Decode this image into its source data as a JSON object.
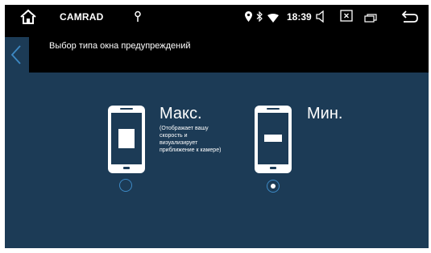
{
  "statusbar": {
    "app_name": "CAMRAD",
    "time": "18:39",
    "icons": [
      "home-icon",
      "pin-icon",
      "location-icon",
      "bluetooth-icon",
      "wifi-icon",
      "volume-icon",
      "close-box-icon",
      "window-icon",
      "back-arrow-icon"
    ]
  },
  "titlebar": {
    "title": "Выбор типа окна предупреждений"
  },
  "options": [
    {
      "label": "Макс.",
      "description": "(Отображает вашу скорость и визуализирует приближение к камере)",
      "selected": false
    },
    {
      "label": "Мин.",
      "description": "",
      "selected": true
    }
  ],
  "colors": {
    "background": "#1c3b56",
    "bar": "#000000",
    "accent": "#3d89c4",
    "text": "#ffffff"
  }
}
